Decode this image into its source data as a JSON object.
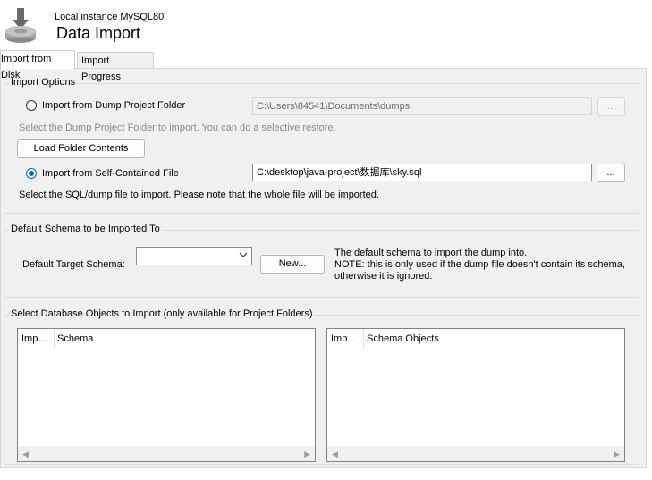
{
  "header": {
    "instance": "Local instance MySQL80",
    "title": "Data Import"
  },
  "tabs": [
    {
      "label": "Import from Disk",
      "active": true
    },
    {
      "label": "Import Progress",
      "active": false
    }
  ],
  "import_options": {
    "group_title": "Import Options",
    "dump_folder_label": "Import from Dump Project Folder",
    "dump_folder_path": "C:\\Users\\84541\\Documents\\dumps",
    "browse_label": "...",
    "dump_folder_hint": "Select the Dump Project Folder to import. You can do a selective restore.",
    "load_button": "Load Folder Contents",
    "self_contained_label": "Import from Self-Contained File",
    "self_contained_path": "C:\\desktop\\java-project\\数据库\\sky.sql",
    "self_contained_hint": "Select the SQL/dump file to import. Please note that the whole file will be imported.",
    "selected_option": "self-contained"
  },
  "default_schema": {
    "group_title": "Default Schema to be Imported To",
    "target_label": "Default Target Schema:",
    "target_value": "",
    "new_button": "New...",
    "note_line1": "The default schema to import the dump into.",
    "note_line2": "NOTE: this is only used if the dump file doesn't contain its schema,",
    "note_line3": "otherwise it is ignored."
  },
  "objects": {
    "group_title": "Select Database Objects to Import (only available for Project Folders)",
    "left_columns": [
      "Imp...",
      "Schema"
    ],
    "right_columns": [
      "Imp...",
      "Schema Objects"
    ]
  },
  "colors": {
    "accent": "#0067c0",
    "panel_bg": "#f0f0f0"
  }
}
